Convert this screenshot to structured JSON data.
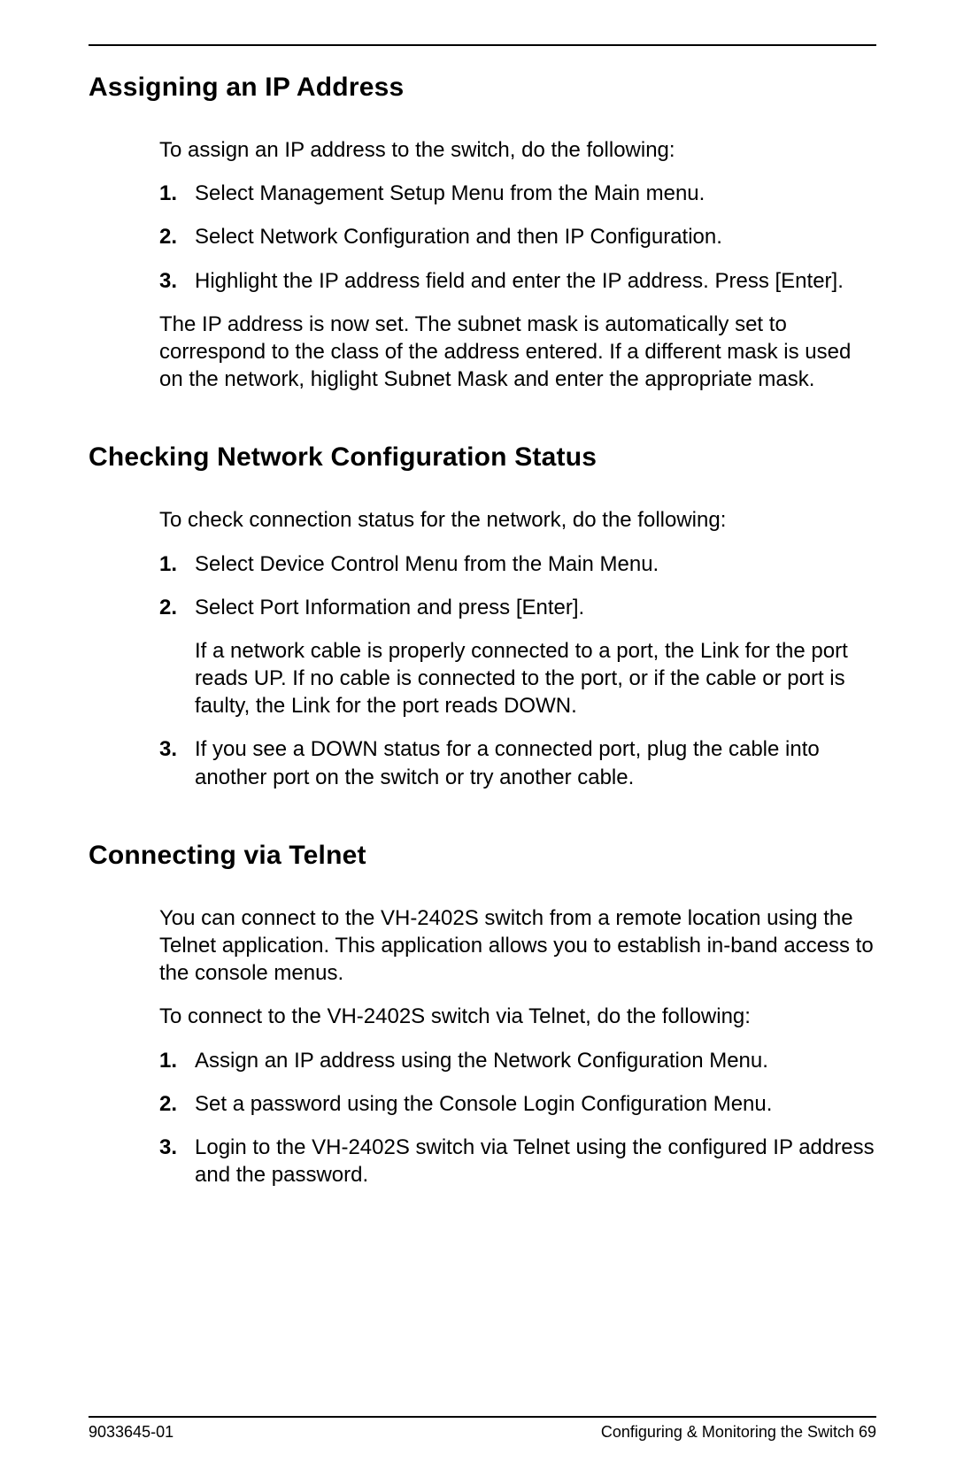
{
  "sections": [
    {
      "heading": "Assigning an IP Address",
      "intro": "To assign an IP address to the switch, do the following:",
      "items": [
        {
          "num": "1.",
          "text": "Select Management Setup Menu from the Main menu."
        },
        {
          "num": "2.",
          "text": "Select Network Configuration and then IP Configuration."
        },
        {
          "num": "3.",
          "text": "Highlight the IP address field and enter the IP address. Press [Enter]."
        }
      ],
      "outro": "The IP address is now set. The subnet mask is automatically set to correspond to the class of the address entered. If a different mask is used on the network, higlight Subnet Mask and enter the appropriate mask."
    },
    {
      "heading": "Checking Network Configuration Status",
      "intro": "To check connection status for the network, do the following:",
      "items": [
        {
          "num": "1.",
          "text": "Select Device Control Menu from the Main Menu."
        },
        {
          "num": "2.",
          "text": "Select Port Information and press [Enter].",
          "sub": "If a network cable is properly connected to a port, the Link for the port reads UP. If no cable is connected to the port, or if the cable or port is faulty, the Link for the port reads DOWN."
        },
        {
          "num": "3.",
          "text": "If you see a DOWN status for a connected port, plug the cable into another port on the switch or try another cable."
        }
      ]
    },
    {
      "heading": "Connecting via Telnet",
      "intro": "You can connect to the VH-2402S switch from a remote location using the Telnet application. This application allows you to establish in-band access to the console menus.",
      "intro2": "To connect to the VH-2402S switch via Telnet, do the following:",
      "items": [
        {
          "num": "1.",
          "text": "Assign an IP address using the Network Configuration Menu."
        },
        {
          "num": "2.",
          "text": "Set a password using the Console Login Configuration Menu."
        },
        {
          "num": "3.",
          "text": "Login to the VH-2402S switch via Telnet using the configured IP address and the password."
        }
      ]
    }
  ],
  "footer": {
    "left": "9033645-01",
    "right": "Configuring & Monitoring the Switch  69"
  }
}
